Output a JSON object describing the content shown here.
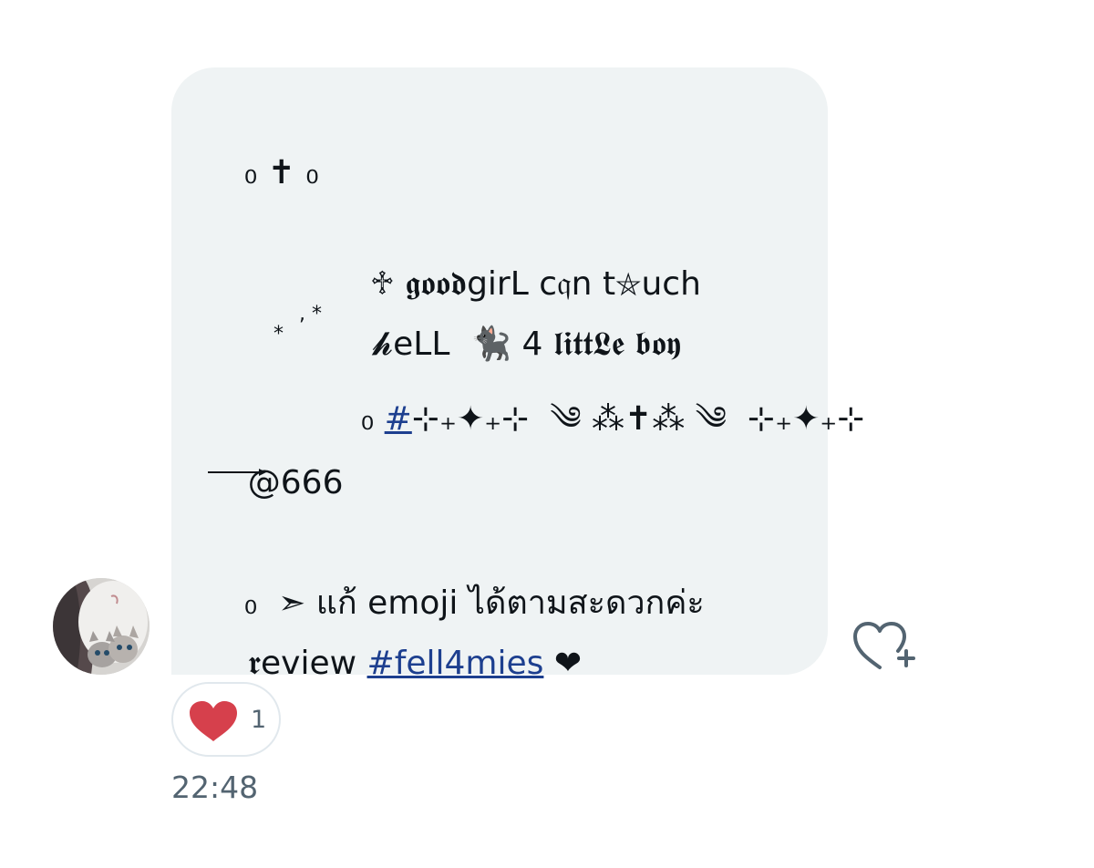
{
  "message": {
    "line1": "₀ ✝ ₀",
    "line2": "♱ 𝖌𝖔𝖔𝖉girL c𝔮n t⛤uch",
    "line3_stars": ", * \n*",
    "line3": "𝓱eLL  🐈‍⬛ 4 𝖑𝖎𝖙𝖙𝕷𝖊 𝖇𝖔𝖞",
    "line4_prefix": "₀ ",
    "hashtag_symbol": "#",
    "line4_decor": "⊹₊✦₊⊹  ༄ ⁂✝⁂ ༄  ⊹₊✦₊⊹",
    "mention": "@666",
    "line6": "₀  ➣ แก้ emoji ได้ตามสะดวกค่ะ",
    "line7_prefix": "𝖗eview ",
    "hashtag": "#fell4mies",
    "line7_suffix": " ❤"
  },
  "reaction": {
    "emoji": "heart-icon",
    "count": "1"
  },
  "timestamp": "22:48",
  "colors": {
    "bubble": "#eff3f4",
    "link": "#1d3f8f",
    "heart": "#d6404c",
    "muted": "#536471"
  }
}
